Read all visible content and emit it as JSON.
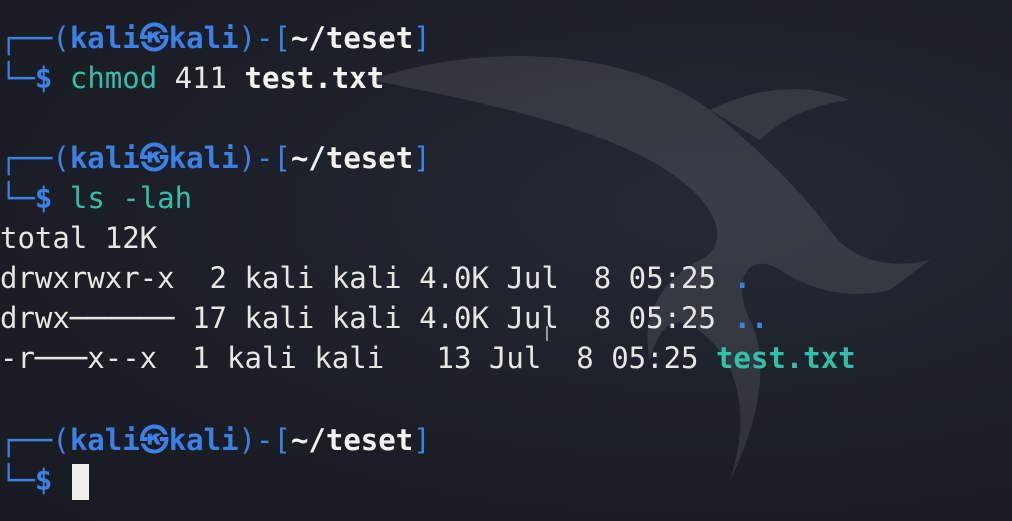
{
  "prompt": {
    "frame_top": "┌──(",
    "user": "kali",
    "separator_icon": "㉿",
    "host": "kali",
    "close": ")-[",
    "cwd": "~/teset",
    "end": "]",
    "frame_bottom": "└─",
    "symbol": "$"
  },
  "commands": [
    {
      "program": "chmod",
      "mode": "411",
      "target": "test.txt"
    },
    {
      "program": "ls",
      "flags": "-lah"
    }
  ],
  "ls_output": {
    "total": "total 12K",
    "rows": [
      {
        "perms": "drwxrwxr-x",
        "links": "2",
        "owner": "kali",
        "group": "kali",
        "size": "4.0K",
        "month": "Jul",
        "day": "8",
        "time": "05:25",
        "name": "."
      },
      {
        "perms": "drwx──────",
        "links": "17",
        "owner": "kali",
        "group": "kali",
        "size": "4.0K",
        "month": "Jul",
        "day": "8",
        "time": "05:25",
        "name": ".."
      },
      {
        "perms": "-r───x--x",
        "links": "1",
        "owner": "kali",
        "group": "kali",
        "size": "13",
        "month": "Jul",
        "day": "8",
        "time": "05:25",
        "name": "test.txt"
      }
    ]
  },
  "icons": {
    "watermark": "kali-dragon-icon",
    "text_cursor": "i-beam-icon"
  },
  "colors": {
    "background": "#1c1f27",
    "prompt_blue": "#3b82e8",
    "command_teal": "#2fc0a8",
    "text": "#e8e8e8"
  }
}
